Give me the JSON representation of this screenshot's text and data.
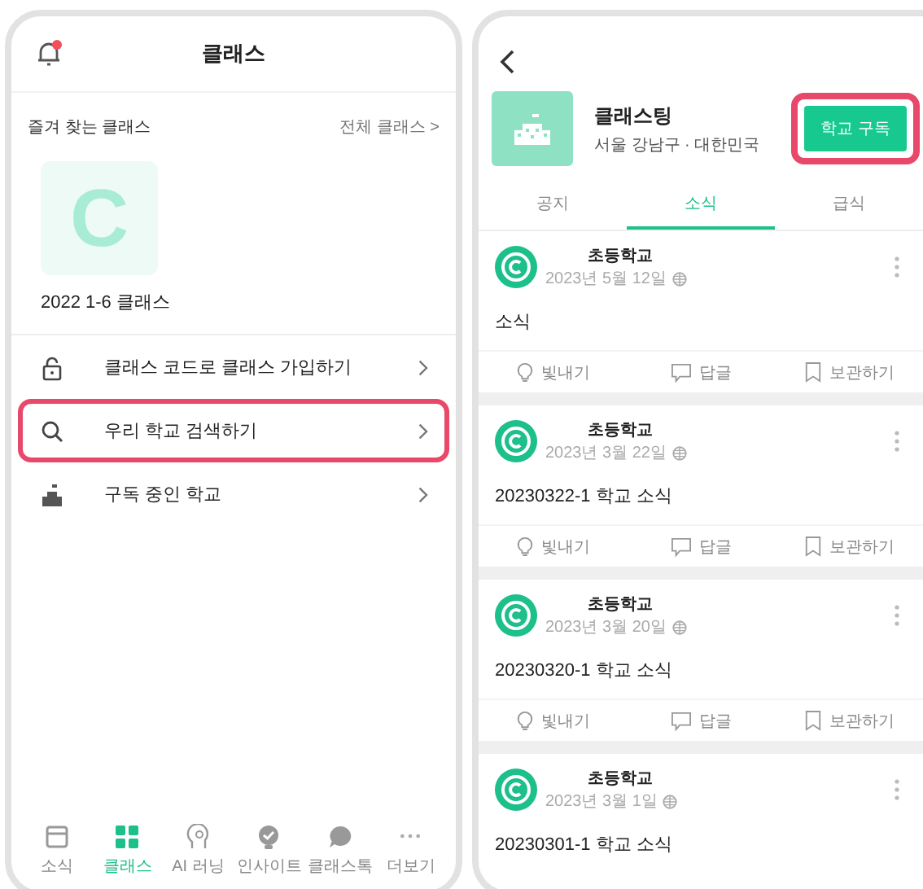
{
  "left_screen": {
    "header": {
      "title": "클래스"
    },
    "favorites": {
      "label": "즐겨 찾는 클래스",
      "link": "전체 클래스 >"
    },
    "classes": [
      {
        "name": "2022 1-6 클래스",
        "letter": "C"
      }
    ],
    "menu": [
      {
        "kind": "lock",
        "label": "클래스 코드로 클래스 가입하기",
        "highlighted": false
      },
      {
        "kind": "search",
        "label": "우리 학교 검색하기",
        "highlighted": true
      },
      {
        "kind": "school",
        "label": "구독 중인 학교",
        "highlighted": false
      }
    ],
    "tab_bar": [
      {
        "kind": "news",
        "label": "소식",
        "selected": false
      },
      {
        "kind": "class",
        "label": "클래스",
        "selected": true
      },
      {
        "kind": "ai",
        "label": "AI 러닝",
        "selected": false
      },
      {
        "kind": "insight",
        "label": "인사이트",
        "selected": false
      },
      {
        "kind": "chat",
        "label": "클래스톡",
        "selected": false
      },
      {
        "kind": "more",
        "label": "더보기",
        "selected": false
      }
    ]
  },
  "right_screen": {
    "school": {
      "name": "클래스팅",
      "location": "서울 강남구 · 대한민국"
    },
    "subscribe_button": {
      "label": "학교 구독",
      "highlighted": true
    },
    "tabs": [
      {
        "label": "공지",
        "selected": false
      },
      {
        "label": "소식",
        "selected": true
      },
      {
        "label": "급식",
        "selected": false
      }
    ],
    "posts": [
      {
        "author": "초등학교",
        "date": "2023년 5월 12일",
        "body": "소식",
        "actions": [
          {
            "kind": "light",
            "label": "빛내기"
          },
          {
            "kind": "comment",
            "label": "답글"
          },
          {
            "kind": "bookmark",
            "label": "보관하기"
          }
        ]
      },
      {
        "author": "초등학교",
        "date": "2023년 3월 22일",
        "body": "20230322-1 학교 소식",
        "actions": [
          {
            "kind": "light",
            "label": "빛내기"
          },
          {
            "kind": "comment",
            "label": "답글"
          },
          {
            "kind": "bookmark",
            "label": "보관하기"
          }
        ]
      },
      {
        "author": "초등학교",
        "date": "2023년 3월 20일",
        "body": "20230320-1 학교 소식",
        "actions": [
          {
            "kind": "light",
            "label": "빛내기"
          },
          {
            "kind": "comment",
            "label": "답글"
          },
          {
            "kind": "bookmark",
            "label": "보관하기"
          }
        ]
      },
      {
        "author": "초등학교",
        "date": "2023년 3월 1일",
        "body": "20230301-1 학교 소식"
      }
    ]
  }
}
